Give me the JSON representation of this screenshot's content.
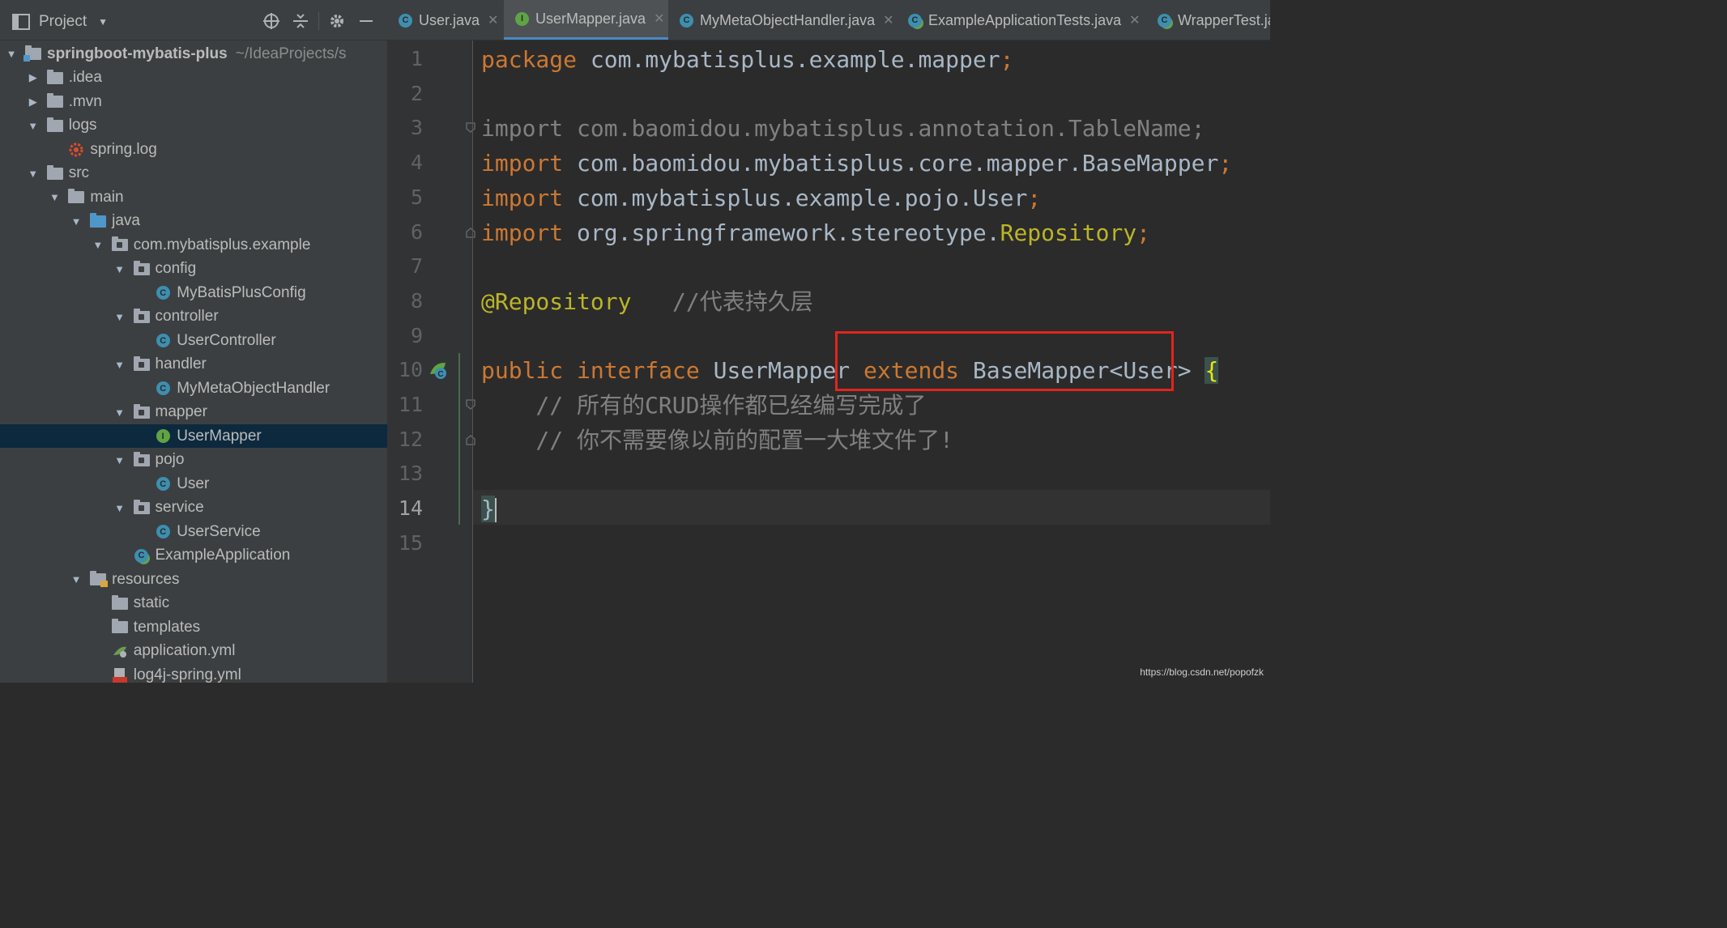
{
  "project_panel": {
    "title": "Project",
    "toolbar": [
      "locate-icon",
      "collapse-all-icon",
      "gear-icon",
      "hide-icon"
    ],
    "tree": [
      {
        "label": "springboot-mybatis-plus",
        "path": "~/IdeaProjects/s",
        "depth": 0,
        "arrow": "down",
        "icon": "module-folder",
        "bold": true
      },
      {
        "label": ".idea",
        "depth": 1,
        "arrow": "right",
        "icon": "folder"
      },
      {
        "label": ".mvn",
        "depth": 1,
        "arrow": "right",
        "icon": "folder"
      },
      {
        "label": "logs",
        "depth": 1,
        "arrow": "down",
        "icon": "folder"
      },
      {
        "label": "spring.log",
        "depth": 2,
        "arrow": "none",
        "icon": "log-file"
      },
      {
        "label": "src",
        "depth": 1,
        "arrow": "down",
        "icon": "folder"
      },
      {
        "label": "main",
        "depth": 2,
        "arrow": "down",
        "icon": "folder"
      },
      {
        "label": "java",
        "depth": 3,
        "arrow": "down",
        "icon": "source-folder"
      },
      {
        "label": "com.mybatisplus.example",
        "depth": 4,
        "arrow": "down",
        "icon": "package"
      },
      {
        "label": "config",
        "depth": 5,
        "arrow": "down",
        "icon": "package"
      },
      {
        "label": "MyBatisPlusConfig",
        "depth": 6,
        "arrow": "none",
        "icon": "class"
      },
      {
        "label": "controller",
        "depth": 5,
        "arrow": "down",
        "icon": "package"
      },
      {
        "label": "UserController",
        "depth": 6,
        "arrow": "none",
        "icon": "class"
      },
      {
        "label": "handler",
        "depth": 5,
        "arrow": "down",
        "icon": "package"
      },
      {
        "label": "MyMetaObjectHandler",
        "depth": 6,
        "arrow": "none",
        "icon": "class"
      },
      {
        "label": "mapper",
        "depth": 5,
        "arrow": "down",
        "icon": "package"
      },
      {
        "label": "UserMapper",
        "depth": 6,
        "arrow": "none",
        "icon": "interface",
        "selected": true
      },
      {
        "label": "pojo",
        "depth": 5,
        "arrow": "down",
        "icon": "package"
      },
      {
        "label": "User",
        "depth": 6,
        "arrow": "none",
        "icon": "class"
      },
      {
        "label": "service",
        "depth": 5,
        "arrow": "down",
        "icon": "package"
      },
      {
        "label": "UserService",
        "depth": 6,
        "arrow": "none",
        "icon": "class"
      },
      {
        "label": "ExampleApplication",
        "depth": 5,
        "arrow": "none",
        "icon": "spring-boot-class"
      },
      {
        "label": "resources",
        "depth": 3,
        "arrow": "down",
        "icon": "resources-folder"
      },
      {
        "label": "static",
        "depth": 4,
        "arrow": "none",
        "icon": "folder"
      },
      {
        "label": "templates",
        "depth": 4,
        "arrow": "none",
        "icon": "folder"
      },
      {
        "label": "application.yml",
        "depth": 4,
        "arrow": "none",
        "icon": "yml-config"
      },
      {
        "label": "log4j-spring.yml",
        "depth": 4,
        "arrow": "none",
        "icon": "yml-file"
      }
    ]
  },
  "tabs": [
    {
      "label": "User.java",
      "icon": "class",
      "active": false
    },
    {
      "label": "UserMapper.java",
      "icon": "interface",
      "active": true
    },
    {
      "label": "MyMetaObjectHandler.java",
      "icon": "class",
      "active": false
    },
    {
      "label": "ExampleApplicationTests.java",
      "icon": "test-class",
      "active": false
    },
    {
      "label": "WrapperTest.ja",
      "icon": "test-class",
      "active": false
    }
  ],
  "editor": {
    "current_line": 14,
    "line_numbers": [
      "1",
      "2",
      "3",
      "4",
      "5",
      "6",
      "7",
      "8",
      "9",
      "10",
      "11",
      "12",
      "13",
      "14",
      "15"
    ],
    "code": {
      "l1": {
        "kw": "package",
        "rest": " com.mybatisplus.example.mapper",
        "semi": ";"
      },
      "l3": {
        "kw": "import",
        "rest": " com.baomidou.mybatisplus.annotation.TableName;"
      },
      "l4": {
        "kw": "import",
        "rest": " com.baomidou.mybatisplus.core.mapper.BaseMapper",
        "semi": ";"
      },
      "l5": {
        "kw": "import",
        "rest": " com.mybatisplus.example.pojo.User",
        "semi": ";"
      },
      "l6": {
        "kw": "import",
        "rest": " org.springframework.stereotype.",
        "ann": "Repository",
        "semi": ";"
      },
      "l8": {
        "ann": "@Repository",
        "comment": "   //代表持久层"
      },
      "l10": {
        "kw1": "public",
        "kw2": " interface",
        "name": " UserMapper ",
        "kw3": "extends",
        "rest": " BaseMapper<User> ",
        "brace": "{"
      },
      "l11": {
        "comment": "    // 所有的CRUD操作都已经编写完成了"
      },
      "l12": {
        "comment": "    // 你不需要像以前的配置一大堆文件了!"
      },
      "l14": {
        "brace": "}"
      }
    }
  },
  "watermark": "https://blog.csdn.net/popofzk",
  "colors": {
    "keyword": "#cc7832",
    "annotation": "#bbb529",
    "comment": "#808080",
    "highlight_box": "#e0251c",
    "tab_active_underline": "#4a88c7"
  }
}
